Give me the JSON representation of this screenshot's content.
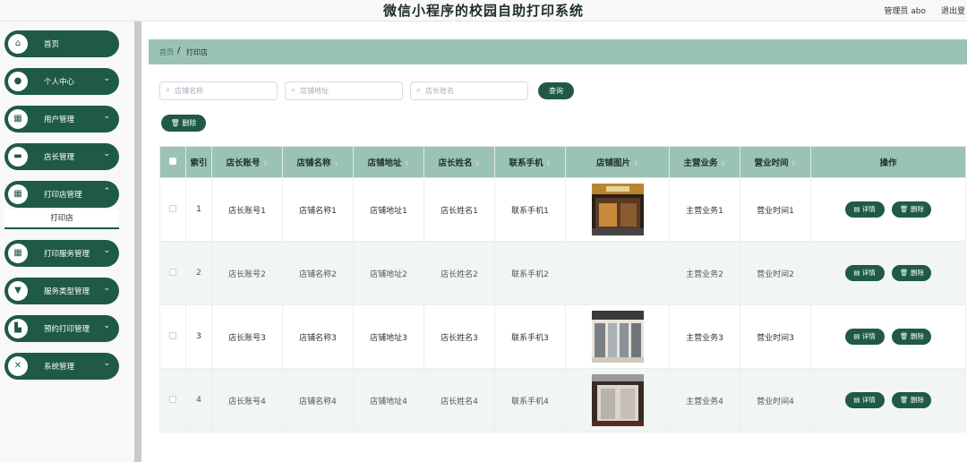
{
  "header": {
    "title": "微信小程序的校园自助打印系统",
    "user": "管理员 abo",
    "logout": "退出登"
  },
  "sidebar": {
    "items": [
      {
        "label": "首页",
        "icon": "home-icon",
        "glyph": "⌂",
        "expandable": false
      },
      {
        "label": "个人中心",
        "icon": "user-icon",
        "glyph": "●",
        "expandable": true
      },
      {
        "label": "用户管理",
        "icon": "grid-icon",
        "glyph": "▦",
        "expandable": true
      },
      {
        "label": "店长管理",
        "icon": "briefcase-icon",
        "glyph": "▬",
        "expandable": true
      },
      {
        "label": "打印店管理",
        "icon": "grid-icon",
        "glyph": "▦",
        "expandable": true
      },
      {
        "label": "打印服务管理",
        "icon": "grid-icon",
        "glyph": "▦",
        "expandable": true
      },
      {
        "label": "服务类型管理",
        "icon": "filter-icon",
        "glyph": "▼",
        "expandable": true
      },
      {
        "label": "预约打印管理",
        "icon": "chart-icon",
        "glyph": "▙",
        "expandable": true
      },
      {
        "label": "系统管理",
        "icon": "settings-icon",
        "glyph": "✕",
        "expandable": true
      }
    ],
    "active_subitem": "打印店"
  },
  "breadcrumb": {
    "home": "首页",
    "separator": "/",
    "current": "打印店"
  },
  "search": {
    "fields": [
      {
        "placeholder": "店铺名称"
      },
      {
        "placeholder": "店铺地址"
      },
      {
        "placeholder": "店长姓名"
      }
    ],
    "query_button": "查询",
    "delete_button": "删除"
  },
  "table": {
    "columns": [
      "索引",
      "店长账号",
      "店铺名称",
      "店铺地址",
      "店长姓名",
      "联系手机",
      "店铺图片",
      "主营业务",
      "营业时间",
      "操作"
    ],
    "detail_label": "详情",
    "delete_label": "删除",
    "rows": [
      {
        "index": "1",
        "account": "店长账号1",
        "shop_name": "店铺名称1",
        "address": "店铺地址1",
        "owner": "店长姓名1",
        "phone": "联系手机1",
        "image": "shop-photo-storefront",
        "business": "主营业务1",
        "hours": "营业时间1"
      },
      {
        "index": "2",
        "account": "店长账号2",
        "shop_name": "店铺名称2",
        "address": "店铺地址2",
        "owner": "店长姓名2",
        "phone": "联系手机2",
        "image": "",
        "business": "主营业务2",
        "hours": "营业时间2"
      },
      {
        "index": "3",
        "account": "店长账号3",
        "shop_name": "店铺名称3",
        "address": "店铺地址3",
        "owner": "店长姓名3",
        "phone": "联系手机3",
        "image": "shop-photo-interior",
        "business": "主营业务3",
        "hours": "营业时间3"
      },
      {
        "index": "4",
        "account": "店长账号4",
        "shop_name": "店铺名称4",
        "address": "店铺地址4",
        "owner": "店长姓名4",
        "phone": "联系手机4",
        "image": "shop-photo-entrance",
        "business": "主营业务4",
        "hours": "营业时间4"
      }
    ]
  },
  "colors": {
    "primary": "#1f5a46",
    "header_bg": "#9ac3b3",
    "row_alt": "#f1f6f4"
  }
}
